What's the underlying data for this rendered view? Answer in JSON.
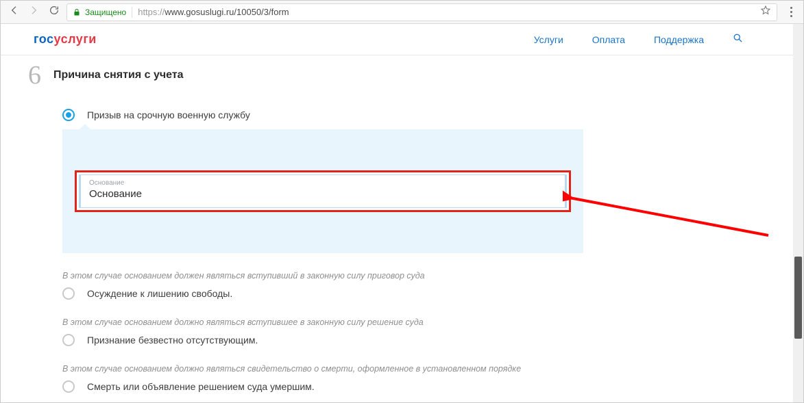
{
  "browser": {
    "secure_label": "Защищено",
    "url_prefix": "https://",
    "url_rest": "www.gosuslugi.ru/10050/3/form"
  },
  "header": {
    "logo_part1": "гос",
    "logo_part2": "услуги",
    "nav": {
      "services": "Услуги",
      "payment": "Оплата",
      "support": "Поддержка"
    }
  },
  "step": {
    "number": "6",
    "title": "Причина снятия с учета"
  },
  "options": {
    "opt1": {
      "label": "Призыв на срочную военную службу",
      "selected": true
    },
    "field": {
      "float_label": "Основание",
      "value": "Основание"
    },
    "opt2": {
      "note": "В этом случае основанием должен являться вступивший в законную силу приговор суда",
      "label": "Осуждение к лишению свободы."
    },
    "opt3": {
      "note": "В этом случае основанием должно являться вступившее в законную силу решение суда",
      "label": "Признание безвестно отсутствующим."
    },
    "opt4": {
      "note": "В этом случае основанием должно являться свидетельство о смерти, оформленное в установленном порядке",
      "label": "Смерть или объявление решением суда умершим."
    }
  }
}
